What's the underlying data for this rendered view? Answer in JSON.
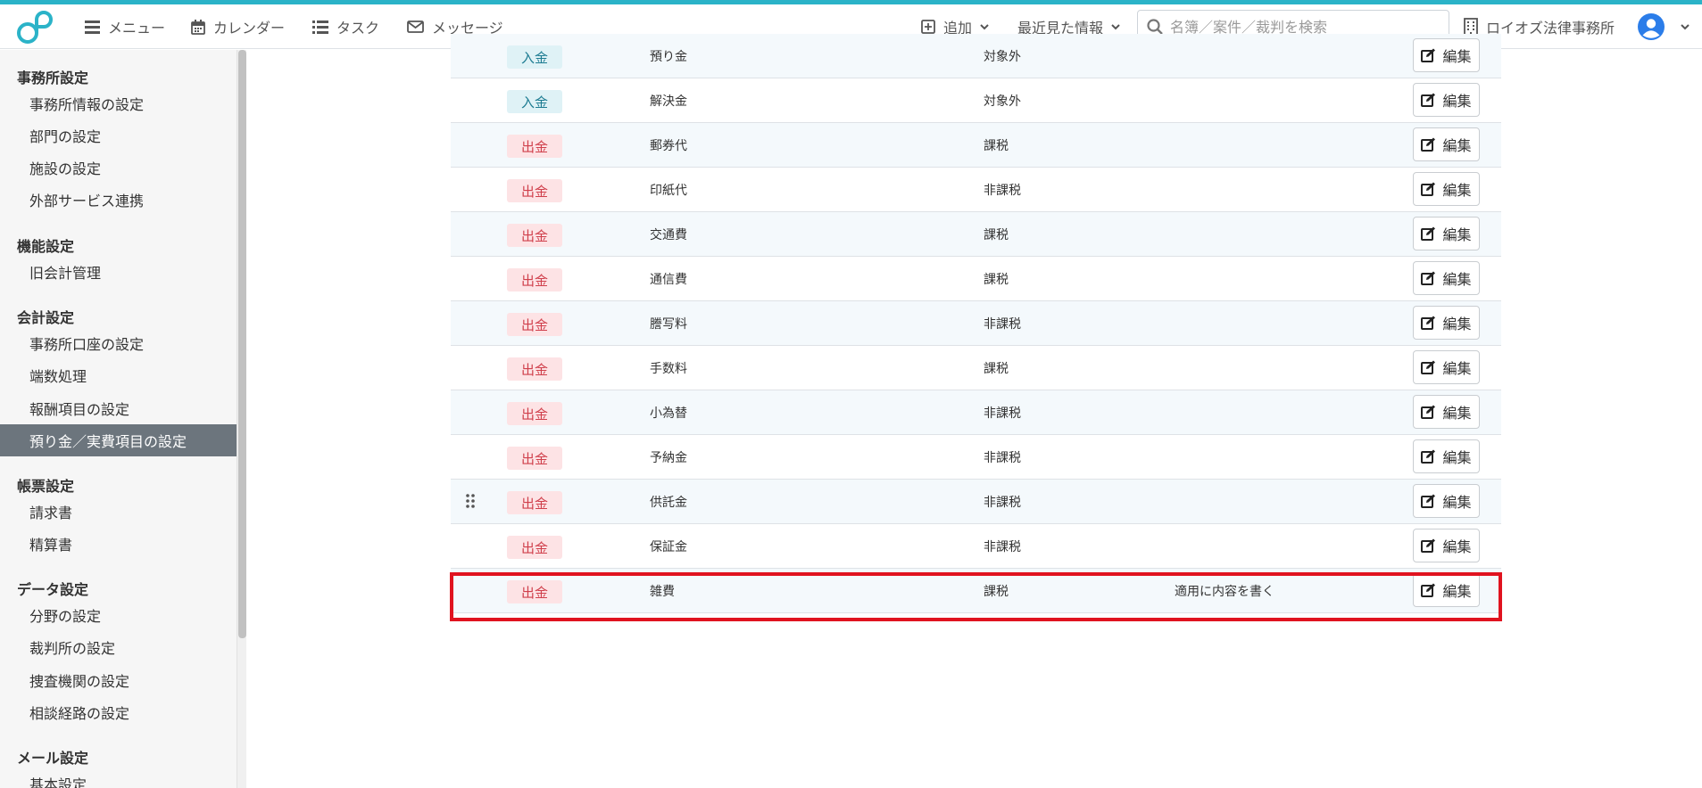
{
  "brand": {
    "accent_color": "#2bb3c8",
    "logo_icon": "loioz-logo-icon"
  },
  "topnav": {
    "menu": "メニュー",
    "calendar": "カレンダー",
    "task": "タスク",
    "message": "メッセージ",
    "add": "追加",
    "recent": "最近見た情報",
    "search_placeholder": "名簿／案件／裁判を検索",
    "office": "ロイオズ法律事務所"
  },
  "sidebar": {
    "sections": [
      {
        "heading": "事務所設定",
        "items": [
          "事務所情報の設定",
          "部門の設定",
          "施設の設定",
          "外部サービス連携"
        ]
      },
      {
        "heading": "機能設定",
        "items": [
          "旧会計管理"
        ]
      },
      {
        "heading": "会計設定",
        "items": [
          "事務所口座の設定",
          "端数処理",
          "報酬項目の設定",
          "預り金／実費項目の設定"
        ]
      },
      {
        "heading": "帳票設定",
        "items": [
          "請求書",
          "精算書"
        ]
      },
      {
        "heading": "データ設定",
        "items": [
          "分野の設定",
          "裁判所の設定",
          "捜査機関の設定",
          "相談経路の設定"
        ]
      },
      {
        "heading": "メール設定",
        "items": [
          "基本設定"
        ]
      }
    ],
    "active_item": "預り金／実費項目の設定"
  },
  "table": {
    "edit_label": "編集",
    "rows": [
      {
        "type": "入金",
        "kind": "in",
        "name": "預り金",
        "tax": "対象外",
        "note": ""
      },
      {
        "type": "入金",
        "kind": "in",
        "name": "解決金",
        "tax": "対象外",
        "note": ""
      },
      {
        "type": "出金",
        "kind": "out",
        "name": "郵券代",
        "tax": "課税",
        "note": ""
      },
      {
        "type": "出金",
        "kind": "out",
        "name": "印紙代",
        "tax": "非課税",
        "note": ""
      },
      {
        "type": "出金",
        "kind": "out",
        "name": "交通費",
        "tax": "課税",
        "note": ""
      },
      {
        "type": "出金",
        "kind": "out",
        "name": "通信費",
        "tax": "課税",
        "note": ""
      },
      {
        "type": "出金",
        "kind": "out",
        "name": "謄写料",
        "tax": "非課税",
        "note": ""
      },
      {
        "type": "出金",
        "kind": "out",
        "name": "手数料",
        "tax": "課税",
        "note": ""
      },
      {
        "type": "出金",
        "kind": "out",
        "name": "小為替",
        "tax": "非課税",
        "note": ""
      },
      {
        "type": "出金",
        "kind": "out",
        "name": "予納金",
        "tax": "非課税",
        "note": ""
      },
      {
        "type": "出金",
        "kind": "out",
        "name": "供託金",
        "tax": "非課税",
        "note": ""
      },
      {
        "type": "出金",
        "kind": "out",
        "name": "保証金",
        "tax": "非課税",
        "note": ""
      },
      {
        "type": "出金",
        "kind": "out",
        "name": "雑費",
        "tax": "課税",
        "note": "適用に内容を書く"
      }
    ],
    "drag_handle_row": 10,
    "highlighted_row": 12,
    "highlight_color": "#e0131f"
  }
}
